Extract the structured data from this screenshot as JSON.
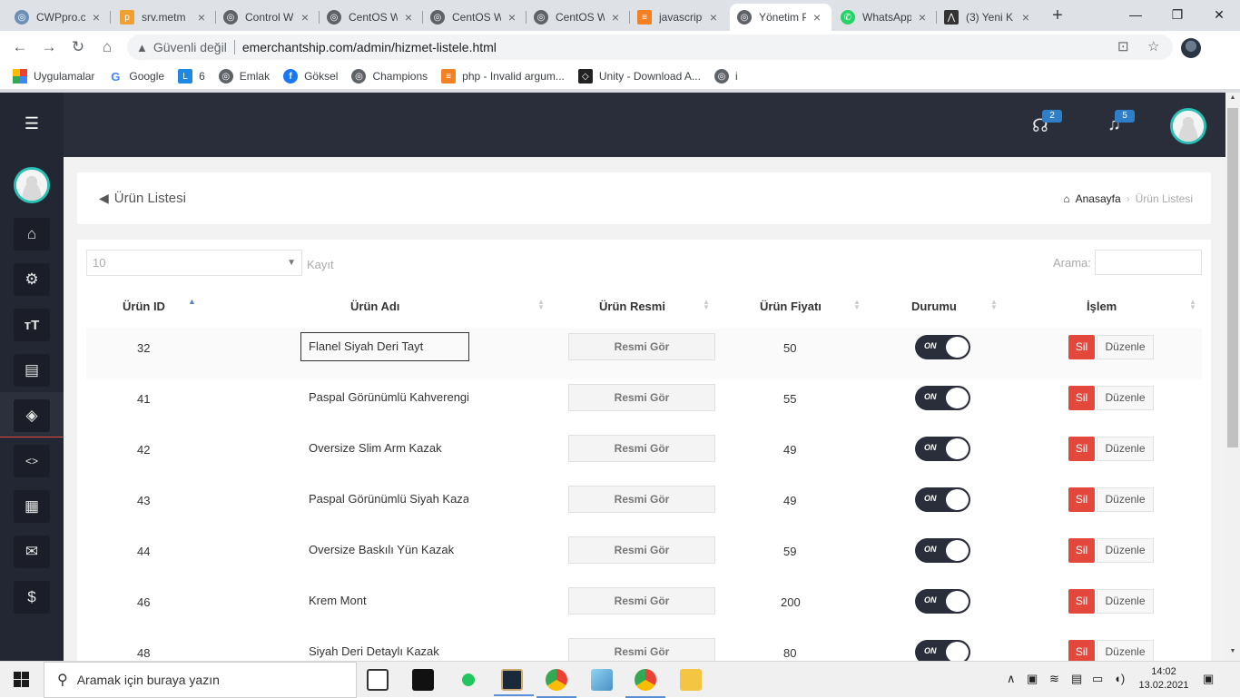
{
  "browser": {
    "tabs": [
      {
        "title": "CWPpro.c",
        "active": false
      },
      {
        "title": "srv.metm",
        "active": false
      },
      {
        "title": "Control W",
        "active": false
      },
      {
        "title": "CentOS W",
        "active": false
      },
      {
        "title": "CentOS W",
        "active": false
      },
      {
        "title": "CentOS W",
        "active": false
      },
      {
        "title": "javascript",
        "active": false
      },
      {
        "title": "Yönetim P",
        "active": true
      },
      {
        "title": "WhatsApp",
        "active": false
      },
      {
        "title": "(3) Yeni K",
        "active": false
      }
    ],
    "security_label": "Güvenli değil",
    "url": "emerchantship.com/admin/hizmet-listele.html",
    "bookmarks": [
      {
        "label": "Uygulamalar",
        "icon": "apps-grid-icon"
      },
      {
        "label": "Google",
        "icon": "google-icon"
      },
      {
        "label": "6",
        "icon": "l-icon"
      },
      {
        "label": "Emlak",
        "icon": "globe-icon"
      },
      {
        "label": "Göksel",
        "icon": "facebook-icon"
      },
      {
        "label": "Champions",
        "icon": "globe-icon"
      },
      {
        "label": "php - Invalid argum...",
        "icon": "stackoverflow-icon"
      },
      {
        "label": "Unity - Download A...",
        "icon": "unity-icon"
      },
      {
        "label": "i",
        "icon": "globe-icon"
      }
    ]
  },
  "topnav": {
    "support_badge": "2",
    "notification_badge": "5"
  },
  "header": {
    "title": "Ürün Listesi",
    "breadcrumb_home": "Anasayfa",
    "breadcrumb_current": "Ürün Listesi"
  },
  "table": {
    "length_value": "10",
    "length_label": "Kayıt",
    "search_label": "Arama:",
    "columns": [
      "Ürün ID",
      "Ürün Adı",
      "Ürün Resmi",
      "Ürün Fiyatı",
      "Durumu",
      "İşlem"
    ],
    "rows": [
      {
        "id": "32",
        "name": "Flanel Siyah  Deri Tayt",
        "image_btn": "Resmi Gör",
        "price": "50",
        "status": "ON",
        "delete": "Sil",
        "edit": "Düzenle"
      },
      {
        "id": "41",
        "name": "Paspal Görünümlü Kahverengi",
        "image_btn": "Resmi Gör",
        "price": "55",
        "status": "ON",
        "delete": "Sil",
        "edit": "Düzenle"
      },
      {
        "id": "42",
        "name": "Oversize Slim Arm Kazak",
        "image_btn": "Resmi Gör",
        "price": "49",
        "status": "ON",
        "delete": "Sil",
        "edit": "Düzenle"
      },
      {
        "id": "43",
        "name": "Paspal Görünümlü Siyah Kazak",
        "image_btn": "Resmi Gör",
        "price": "49",
        "status": "ON",
        "delete": "Sil",
        "edit": "Düzenle"
      },
      {
        "id": "44",
        "name": "Oversize Baskılı Yün Kazak",
        "image_btn": "Resmi Gör",
        "price": "59",
        "status": "ON",
        "delete": "Sil",
        "edit": "Düzenle"
      },
      {
        "id": "46",
        "name": "Krem Mont",
        "image_btn": "Resmi Gör",
        "price": "200",
        "status": "ON",
        "delete": "Sil",
        "edit": "Düzenle"
      },
      {
        "id": "48",
        "name": "Siyah Deri Detaylı Kazak",
        "image_btn": "Resmi Gör",
        "price": "80",
        "status": "ON",
        "delete": "Sil",
        "edit": "Düzenle"
      }
    ]
  },
  "taskbar": {
    "search_placeholder": "Aramak için buraya yazın",
    "time": "14:02",
    "date": "13.02.2021"
  }
}
